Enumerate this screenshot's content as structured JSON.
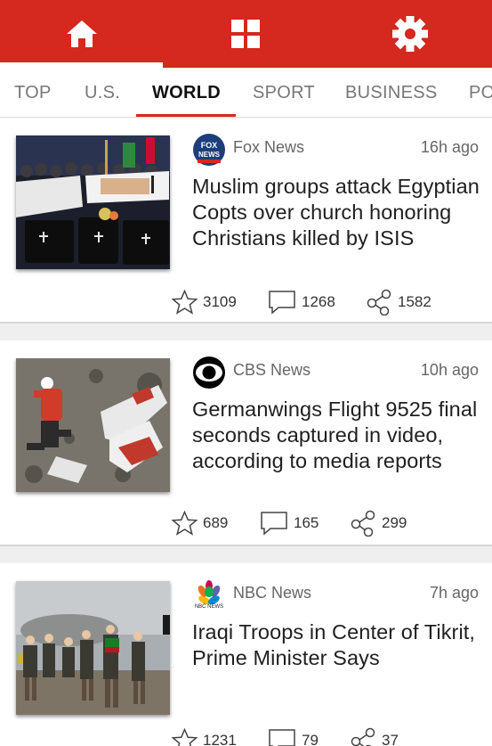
{
  "colors": {
    "brand_red": "#d5281f",
    "tab_active": "#111111",
    "tab_inactive": "#777777"
  },
  "topbar": {
    "home_icon": "home-icon",
    "grid_icon": "grid-icon",
    "settings_icon": "gear-icon"
  },
  "tabs": [
    {
      "label": "TOP"
    },
    {
      "label": "U.S."
    },
    {
      "label": "WORLD",
      "active": true
    },
    {
      "label": "SPORT"
    },
    {
      "label": "BUSINESS"
    },
    {
      "label": "PO"
    }
  ],
  "articles": [
    {
      "source": "Fox News",
      "time": "16h ago",
      "headline": "Muslim groups attack Egyptian Copts over church honoring Christians killed by ISIS",
      "likes": "3109",
      "comments": "1268",
      "shares": "1582",
      "logo_text": "FOX NEWS"
    },
    {
      "source": "CBS News",
      "time": "10h ago",
      "headline": "Germanwings Flight 9525 final seconds captured in video, according to media reports",
      "likes": "689",
      "comments": "165",
      "shares": "299"
    },
    {
      "source": "NBC News",
      "time": "7h ago",
      "headline": "Iraqi Troops in Center of Tikrit, Prime Minister Says",
      "likes": "1231",
      "comments": "79",
      "shares": "37",
      "logo_text": "NBC NEWS"
    }
  ]
}
